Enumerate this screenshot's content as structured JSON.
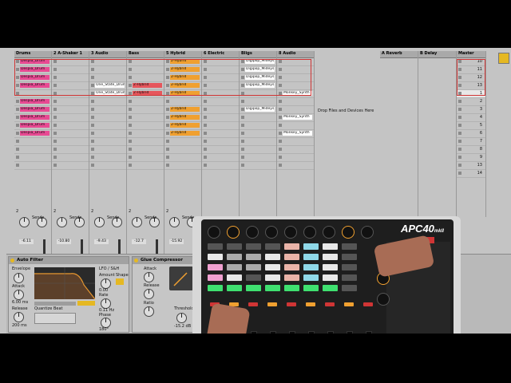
{
  "tracks": [
    {
      "name": "Drums",
      "color": "#e84a93",
      "clips": [
        "Despia_Drum",
        "Despia_Drum",
        "Despia_Drum",
        "Despia_Drum",
        "",
        "Despia_Drum",
        "Despia_Drum",
        "Despia_Drum",
        "Despia_Drum",
        "Despia_Drum"
      ],
      "number": "2",
      "send": "-6.11",
      "badge": "1"
    },
    {
      "name": "2 A-Shaker 1",
      "color": "#9edaf2",
      "clips": [
        "",
        "",
        "",
        "",
        "",
        "",
        "",
        "",
        "",
        ""
      ],
      "number": "2",
      "send": "-10.80",
      "badge": "2"
    },
    {
      "name": "3 Audio",
      "color": "#ffffff",
      "clips": [
        "",
        "",
        "",
        "One_State_Drum",
        "One_State_Drum",
        "",
        "",
        "",
        "",
        ""
      ],
      "number": "2",
      "send": "-9.43",
      "badge": "3"
    },
    {
      "name": "Bass",
      "color": "#e6565c",
      "clips": [
        "",
        "",
        "",
        "2-Hybrid",
        "2-Hybrid",
        "",
        "",
        "",
        "",
        ""
      ],
      "number": "2",
      "send": "-12.7",
      "badge": "4"
    },
    {
      "name": "5 Hybrid",
      "color": "#f0a030",
      "clips": [
        "2-Hybrid",
        "2-Hybrid",
        "2-Hybrid",
        "2-Hybrid",
        "2-Hybrid",
        "",
        "2-Hybrid",
        "2-Hybrid",
        "2-Hybrid",
        "2-Hybrid"
      ],
      "number": "2",
      "send": "-15.92",
      "badge": "5"
    },
    {
      "name": "6 Electric",
      "color": "#49e5ea",
      "clips": [
        "",
        "",
        "",
        "",
        "",
        "",
        "",
        "",
        "",
        ""
      ],
      "number": "2",
      "send": "",
      "badge": ""
    },
    {
      "name": "Bligs",
      "color": "#ffffff",
      "clips": [
        "Digipop_Mideys",
        "Digipop_Mideys",
        "Digipop_Mideys",
        "Digipop_Mideys",
        "",
        "",
        "Digipop_Mideys",
        "",
        "",
        ""
      ],
      "number": "",
      "send": "",
      "badge": ""
    },
    {
      "name": "8 Audio",
      "color": "#ffffff",
      "clips": [
        "",
        "",
        "",
        "",
        "Monkey_Synth",
        "",
        "",
        "Monkey_Synth",
        "",
        "Monkey_Synth"
      ],
      "number": "",
      "send": "",
      "badge": ""
    }
  ],
  "returns": [
    {
      "name": "A Reverb"
    },
    {
      "name": "B Delay"
    }
  ],
  "master": {
    "name": "Master",
    "scenes": [
      "10",
      "11",
      "12",
      "13",
      "1",
      "2",
      "3",
      "4",
      "5",
      "6",
      "7",
      "8",
      "9",
      "13",
      "14"
    ]
  },
  "drop_text": "Drop Files and Devices Here",
  "sends_label": "Sends",
  "devices": [
    {
      "name": "Auto Filter",
      "labels": [
        "Envelope",
        "Attack",
        "Release",
        "Quantize Beat",
        "LFO / S&H",
        "Amount",
        "Rate",
        "Shape",
        "Phase"
      ],
      "values": [
        "6.00 ms",
        "200 ms",
        "0.00",
        "0.11 Hz",
        "180°"
      ]
    },
    {
      "name": "Glue Compressor",
      "labels": [
        "Attack",
        "Release",
        "Ratio",
        "Threshold"
      ],
      "values": [
        "-15.2 dB"
      ]
    }
  ],
  "controller": {
    "brand": "APC40",
    "model": "mkII"
  },
  "colors": {
    "clip_slot": "#c4c4c4",
    "record": "#d03535",
    "selection": "#cc2a2a",
    "accent": "#e5b822"
  }
}
